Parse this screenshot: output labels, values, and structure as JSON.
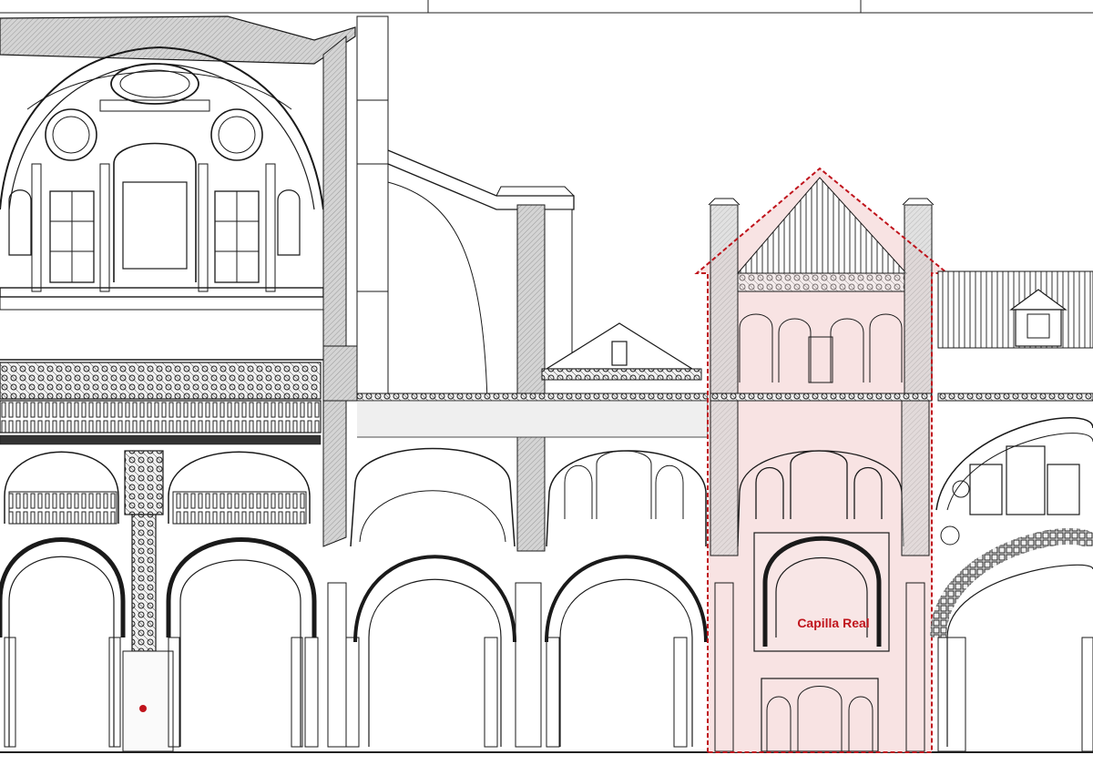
{
  "drawing": {
    "highlight_label": "Capilla Real",
    "highlight_color": "#c0141c",
    "highlight_fill": "#f6dcdc",
    "line_color": "#1a1a1a",
    "wall_hatch_color": "#9a9a9a"
  }
}
